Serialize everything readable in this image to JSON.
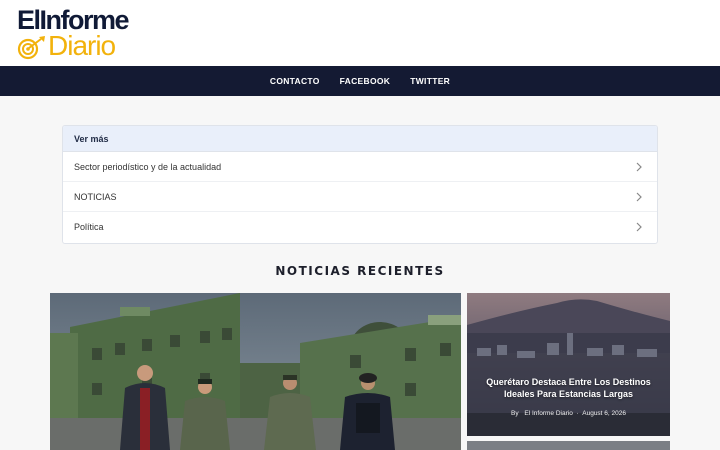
{
  "brand": {
    "name_line1": "ElInforme",
    "name_line2": "Diario",
    "colors": {
      "navy": "#141a33",
      "gold": "#f2b20c"
    }
  },
  "nav": {
    "items": [
      {
        "label": "CONTACTO"
      },
      {
        "label": "FACEBOOK"
      },
      {
        "label": "TWITTER"
      }
    ]
  },
  "more": {
    "title": "Ver más",
    "items": [
      {
        "label": "Sector periodístico y de la actualidad",
        "icon": "chevron-right-icon"
      },
      {
        "label": "NOTICIAS",
        "icon": "chevron-right-icon"
      },
      {
        "label": "Política",
        "icon": "chevron-right-icon"
      }
    ]
  },
  "recent": {
    "title": "NOTICIAS RECIENTES",
    "side_card": {
      "title": "Querétaro Destaca Entre Los Destinos Ideales Para Estancias Largas",
      "by": "By",
      "author": "El Informe Diario",
      "date": "August 6, 2026"
    }
  }
}
